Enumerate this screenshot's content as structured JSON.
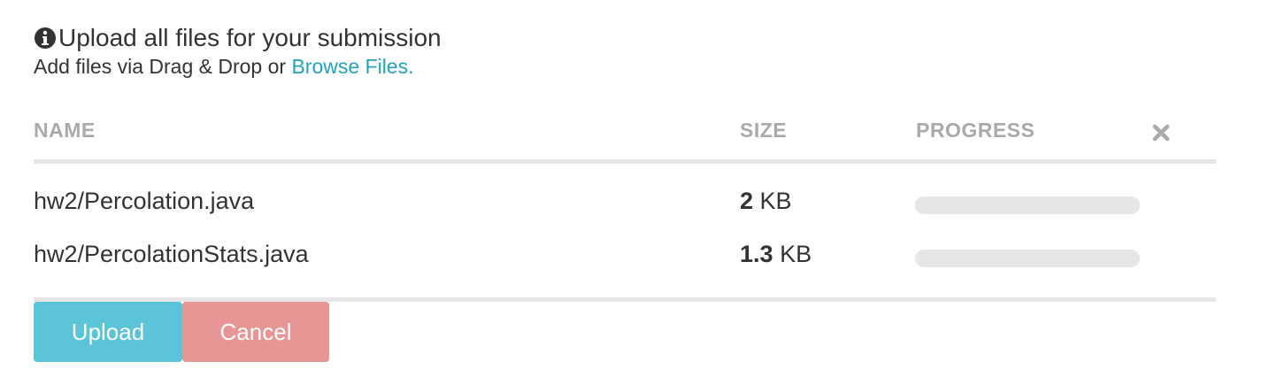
{
  "header": {
    "title": "Upload all files for your submission",
    "subtitle_prefix": "Add files via Drag & Drop or ",
    "browse_link": "Browse Files."
  },
  "table": {
    "columns": {
      "name": "NAME",
      "size": "SIZE",
      "progress": "PROGRESS"
    },
    "files": [
      {
        "name": "hw2/Percolation.java",
        "size_value": "2",
        "size_unit": "KB",
        "progress": 0
      },
      {
        "name": "hw2/PercolationStats.java",
        "size_value": "1.3",
        "size_unit": "KB",
        "progress": 0
      }
    ]
  },
  "actions": {
    "upload_label": "Upload",
    "cancel_label": "Cancel"
  },
  "icons": {
    "header": "info-icon",
    "remove_all": "close-icon"
  },
  "colors": {
    "link": "#1fa3bf",
    "upload": "#5bc4d8",
    "cancel": "#e79595",
    "header_text": "#aaaaaa",
    "divider": "#e6e6e6"
  }
}
